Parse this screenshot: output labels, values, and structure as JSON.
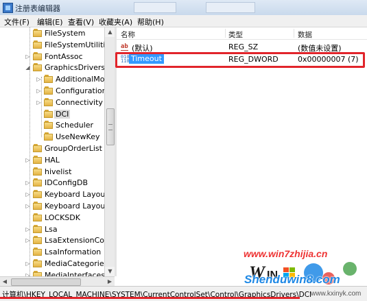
{
  "window": {
    "title": "注册表编辑器"
  },
  "menu": [
    "文件(F)",
    "编辑(E)",
    "查看(V)",
    "收藏夹(A)",
    "帮助(H)"
  ],
  "tree": [
    {
      "label": "FileSystem",
      "expander": ""
    },
    {
      "label": "FileSystemUtilities",
      "expander": ""
    },
    {
      "label": "FontAssoc",
      "expander": "▷"
    },
    {
      "label": "GraphicsDrivers",
      "expander": "◢"
    },
    {
      "label": "AdditionalModeLists",
      "expander": "▷"
    },
    {
      "label": "Configuration",
      "expander": "▷"
    },
    {
      "label": "Connectivity",
      "expander": "▷"
    },
    {
      "label": "DCI",
      "expander": "",
      "selected": true
    },
    {
      "label": "Scheduler",
      "expander": ""
    },
    {
      "label": "UseNewKey",
      "expander": ""
    },
    {
      "label": "GroupOrderList",
      "expander": ""
    },
    {
      "label": "HAL",
      "expander": "▷"
    },
    {
      "label": "hivelist",
      "expander": ""
    },
    {
      "label": "IDConfigDB",
      "expander": "▷"
    },
    {
      "label": "Keyboard Layout",
      "expander": "▷"
    },
    {
      "label": "Keyboard Layouts",
      "expander": "▷"
    },
    {
      "label": "LOCKSDK",
      "expander": ""
    },
    {
      "label": "Lsa",
      "expander": "▷"
    },
    {
      "label": "LsaExtensionConfig",
      "expander": "▷"
    },
    {
      "label": "LsaInformation",
      "expander": ""
    },
    {
      "label": "MediaCategories",
      "expander": "▷"
    },
    {
      "label": "MediaInterfaces",
      "expander": "▷"
    }
  ],
  "list": {
    "headers": {
      "name": "名称",
      "type": "类型",
      "data": "数据"
    },
    "rows": [
      {
        "icon": "string-value-icon",
        "name": "(默认)",
        "type": "REG_SZ",
        "data": "(数值未设置)"
      },
      {
        "icon": "dword-value-icon",
        "name": "Timeout",
        "type": "REG_DWORD",
        "data": "0x00000007 (7)",
        "editing": true
      }
    ]
  },
  "status": {
    "path": "计算机\\HKEY_LOCAL_MACHINE\\SYSTEM\\CurrentControlSet\\Control\\GraphicsDrivers\\DCI"
  },
  "watermark": {
    "site1": "www.win7zhijia.cn",
    "site2": "Shenduwin8.com",
    "site3": "www.kxinyk.com"
  },
  "colors": {
    "highlight": "#e1242a",
    "selection": "#3399ff"
  }
}
